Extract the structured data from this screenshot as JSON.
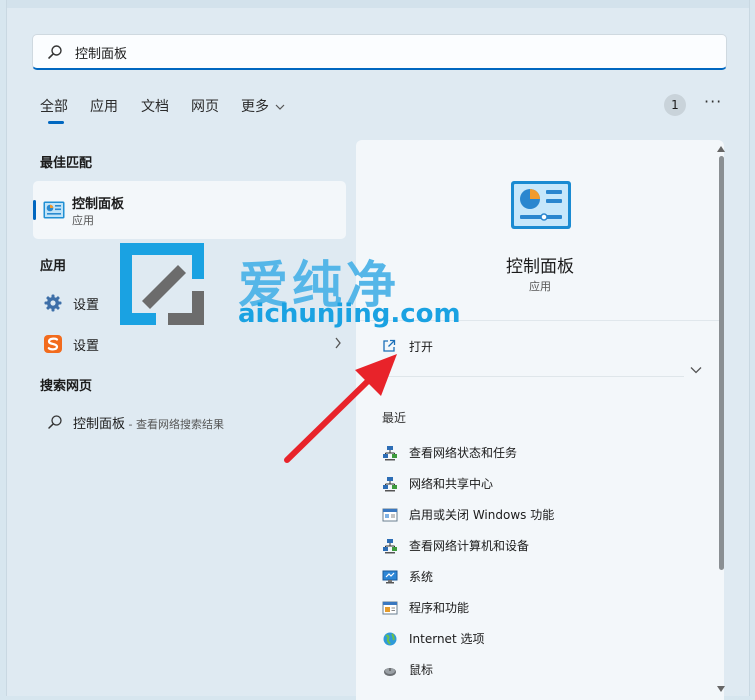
{
  "search": {
    "value": "控制面板"
  },
  "tabs": [
    {
      "label": "全部"
    },
    {
      "label": "应用"
    },
    {
      "label": "文档"
    },
    {
      "label": "网页"
    },
    {
      "label": "更多"
    }
  ],
  "badge_count": "1",
  "more_menu_glyph": "···",
  "left": {
    "best_match_header": "最佳匹配",
    "best_match": {
      "title": "控制面板",
      "subtitle": "应用"
    },
    "apps_header": "应用",
    "apps": [
      {
        "label": "设置",
        "icon": "gear-icon"
      },
      {
        "label": "设置",
        "icon": "sogou-s-icon"
      }
    ],
    "web_header": "搜索网页",
    "web_result": {
      "label": "控制面板",
      "suffix": " - 查看网络搜索结果"
    }
  },
  "right": {
    "title": "控制面板",
    "subtitle": "应用",
    "open_label": "打开",
    "recent_header": "最近",
    "recent": [
      {
        "label": "查看网络状态和任务",
        "icon": "network-icon"
      },
      {
        "label": "网络和共享中心",
        "icon": "network-icon"
      },
      {
        "label": "启用或关闭 Windows 功能",
        "icon": "windows-features-icon"
      },
      {
        "label": "查看网络计算机和设备",
        "icon": "network-icon"
      },
      {
        "label": "系统",
        "icon": "system-monitor-icon"
      },
      {
        "label": "程序和功能",
        "icon": "programs-icon"
      },
      {
        "label": "Internet 选项",
        "icon": "internet-globe-icon"
      },
      {
        "label": "鼠标",
        "icon": "mouse-icon"
      }
    ]
  },
  "watermark": {
    "text": "爱纯净",
    "url": "aichunjing.com"
  },
  "colors": {
    "accent": "#0067c0",
    "arrow": "#e8232a",
    "watermark": "#1aa2e2"
  }
}
